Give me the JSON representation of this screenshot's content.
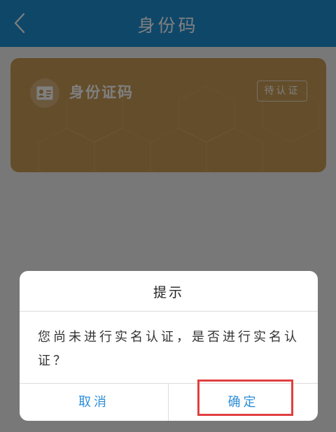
{
  "header": {
    "title": "身份码",
    "back_icon": "chevron-left-icon"
  },
  "card": {
    "icon": "id-card-icon",
    "title": "身份证码",
    "status": "待认证"
  },
  "dialog": {
    "title": "提示",
    "message": "您尚未进行实名认证，是否进行实名认证？",
    "cancel_label": "取消",
    "confirm_label": "确定"
  },
  "colors": {
    "header": "#1f8fd3",
    "card": "#c99b55",
    "button_text": "#2d8ed8",
    "highlight": "#e04040"
  }
}
